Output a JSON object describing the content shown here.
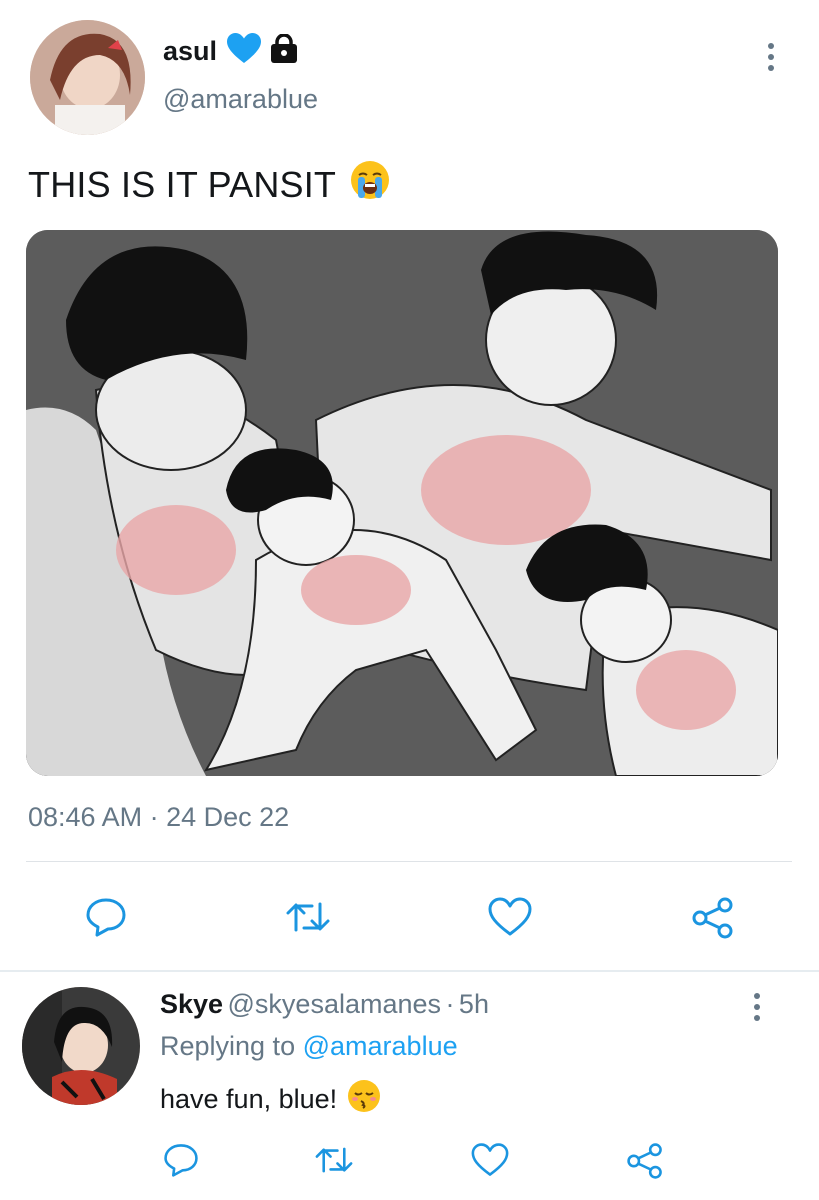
{
  "tweet": {
    "author_name": "asul",
    "author_handle": "@amarablue",
    "text": "THIS IS IT PANSIT",
    "text_emoji": "loudly-crying-face",
    "time": "08:46 AM",
    "separator": "·",
    "date": "24 Dec 22",
    "badges": [
      "blue-heart-icon",
      "lock-icon"
    ]
  },
  "reply": {
    "author_name": "Skye",
    "author_handle": "@skyesalamanes",
    "separator": "·",
    "age": "5h",
    "replying_prefix": "Replying to",
    "replying_mention": "@amarablue",
    "text": "have fun, blue!",
    "text_emoji": "kissing-face-with-closed-eyes"
  },
  "colors": {
    "secondary_text": "#657786",
    "link": "#1da1f2",
    "icon": "#1b95e0",
    "heart_badge": "#1da1f2"
  }
}
